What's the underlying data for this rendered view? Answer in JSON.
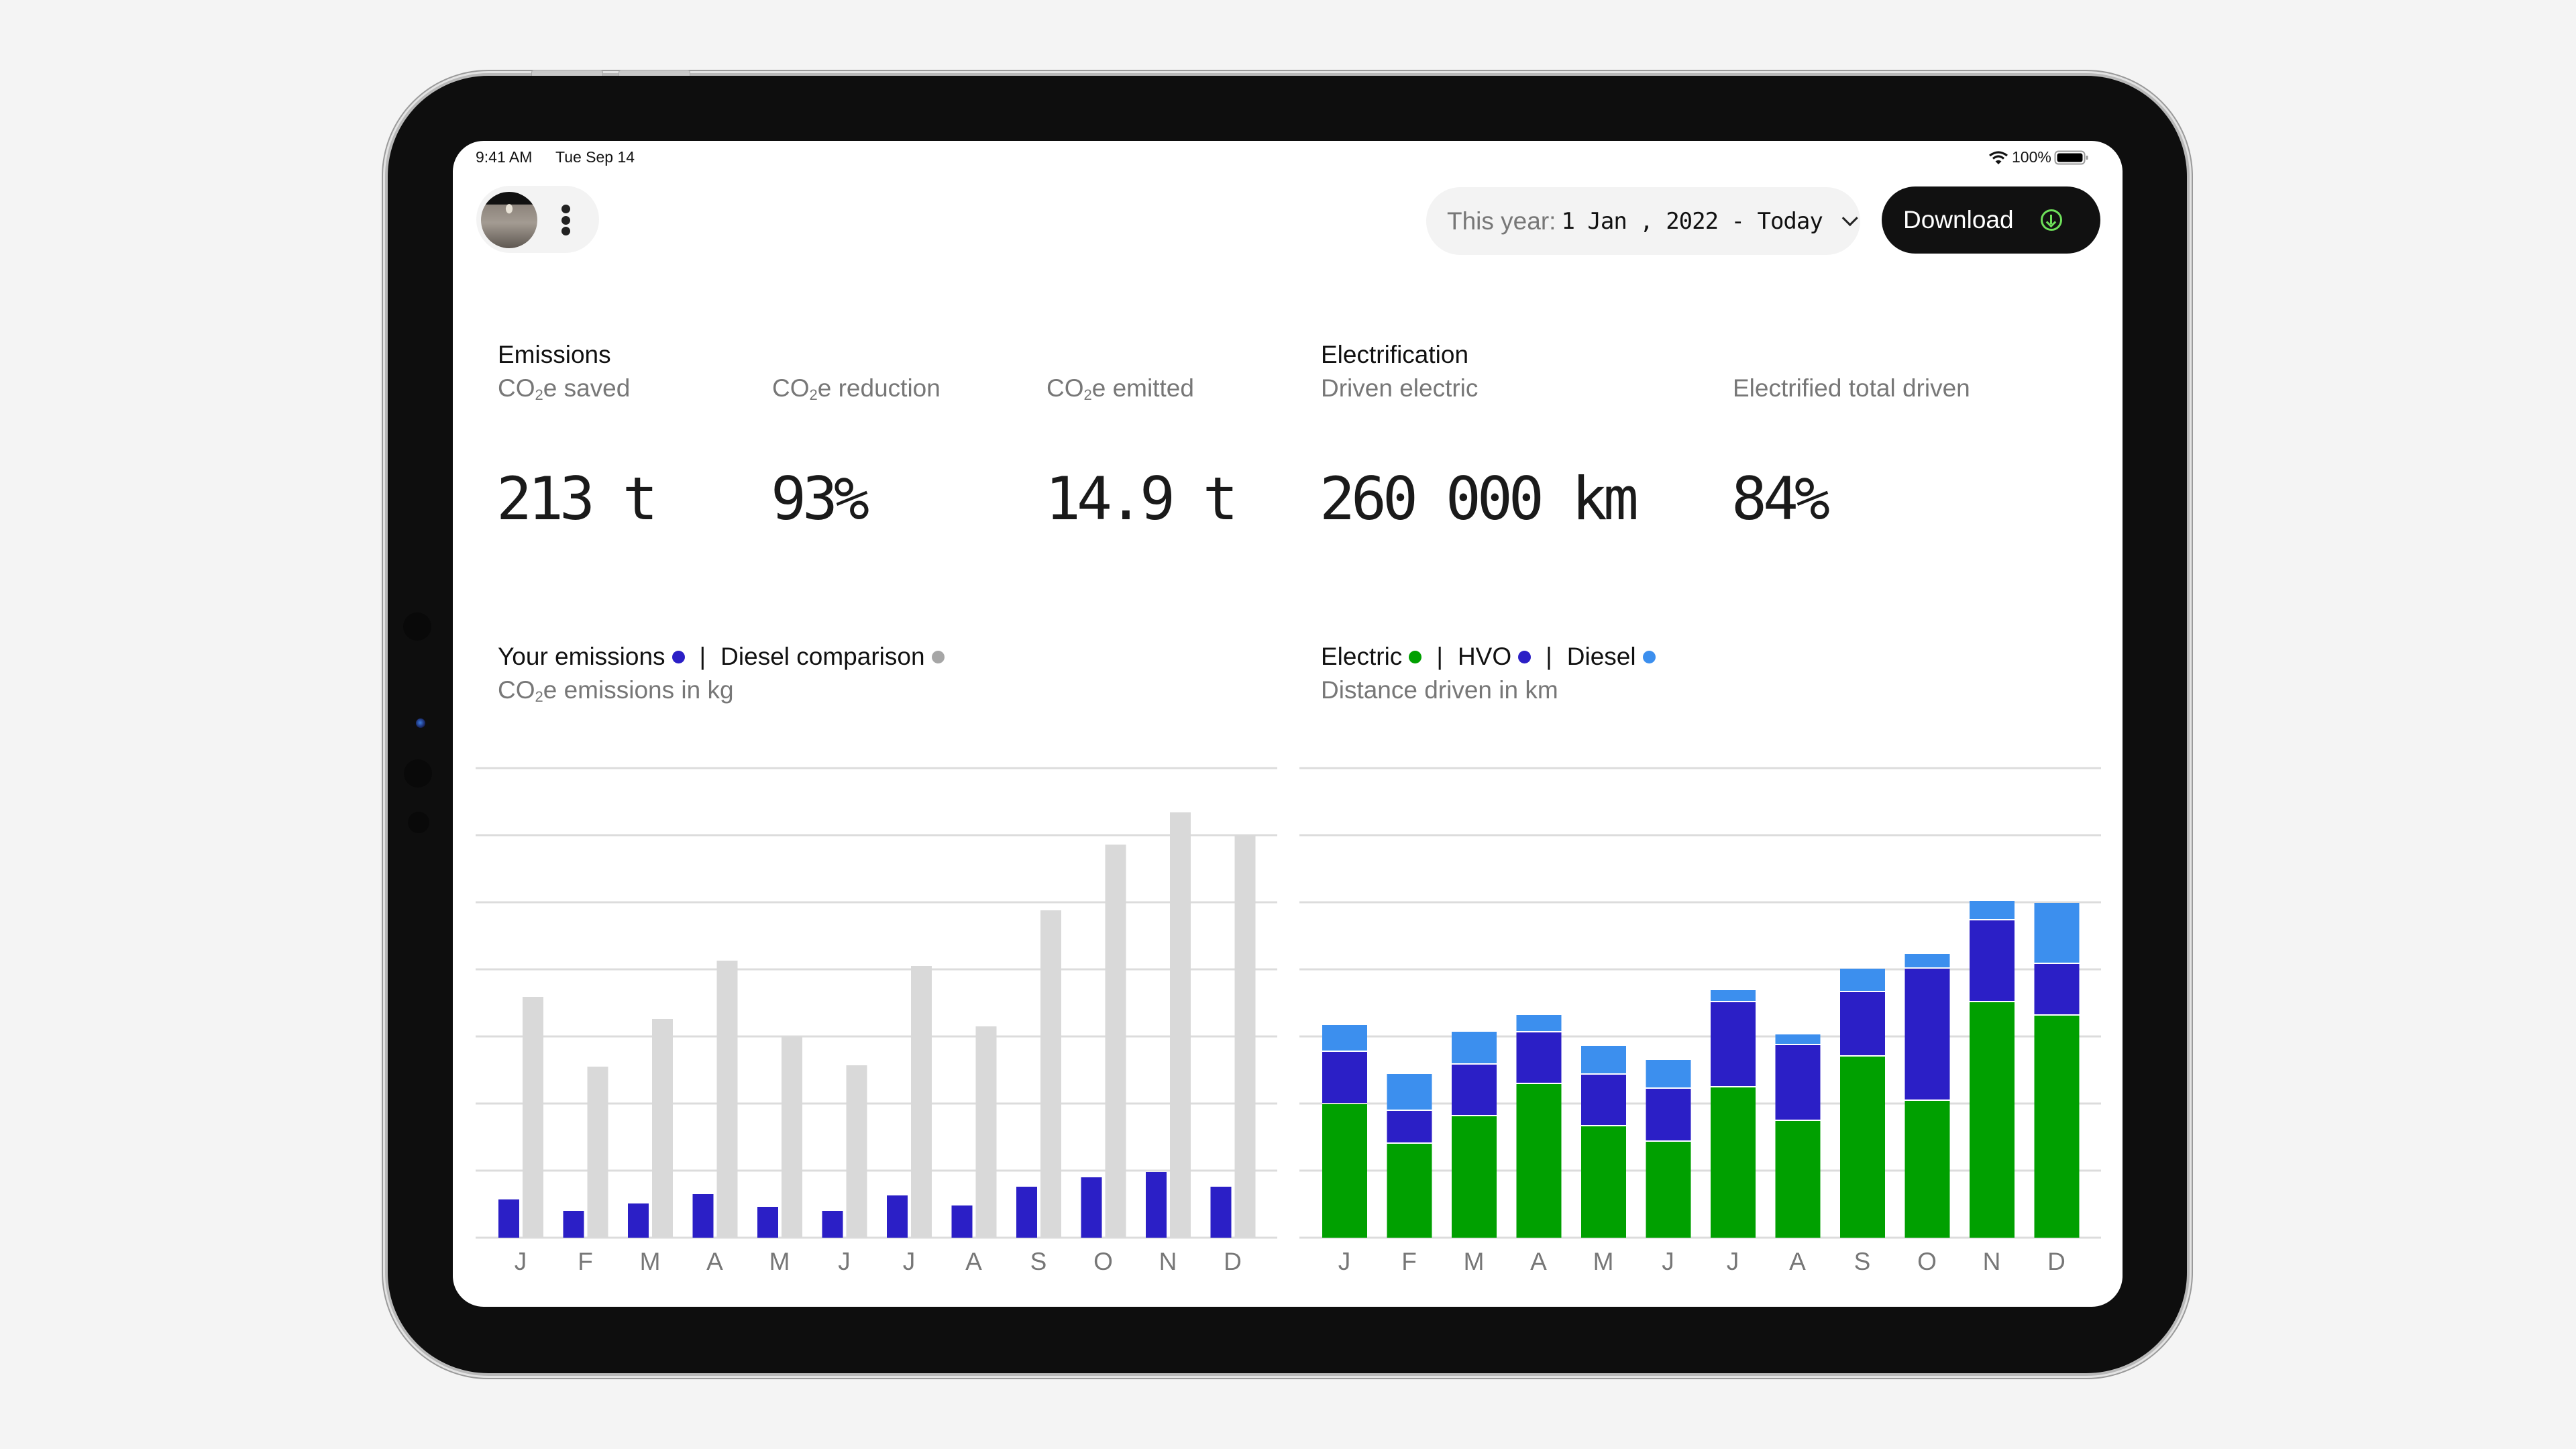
{
  "status_bar": {
    "time": "9:41 AM",
    "date": "Tue Sep 14",
    "battery": "100%",
    "wifi_icon": "wifi-icon",
    "battery_icon": "battery-icon"
  },
  "header": {
    "avatar_icon": "astronaut-avatar",
    "menu_icon": "more-vertical-icon",
    "date_filter": {
      "label": "This year:",
      "value": "1 Jan , 2022 - Today",
      "icon": "chevron-down-icon"
    },
    "download": {
      "label": "Download",
      "icon": "download-circle-icon",
      "icon_color": "#6ee05a"
    }
  },
  "emissions": {
    "title": "Emissions",
    "kpis": [
      {
        "label_pre": "CO",
        "label_sub": "2",
        "label_post": "e saved",
        "value": "213 t"
      },
      {
        "label_pre": "CO",
        "label_sub": "2",
        "label_post": "e reduction",
        "value": "93%"
      },
      {
        "label_pre": "CO",
        "label_sub": "2",
        "label_post": "e emitted",
        "value": "14.9 t"
      }
    ]
  },
  "electrification": {
    "title": "Electrification",
    "kpis": [
      {
        "label": "Driven electric",
        "value": "260 000 km"
      },
      {
        "label": "Electrified total driven",
        "value": "84%"
      }
    ]
  },
  "colors": {
    "your_emissions": "#2b1fc6",
    "diesel_comparison": "#d9d9d9",
    "diesel_comparison_dot": "#a6a6a6",
    "electric": "#00a000",
    "hvo": "#2b1fc6",
    "diesel": "#3c8fee",
    "grid": "#dcdcdc",
    "axis_label": "#777777"
  },
  "chart_data": [
    {
      "type": "bar",
      "title": "Your emissions | Diesel comparison",
      "legend": [
        "Your emissions",
        "Diesel comparison"
      ],
      "subtitle_pre": "CO",
      "subtitle_sub": "2",
      "subtitle_post": "e emissions in kg",
      "ylabel": "CO2e emissions in kg (unlabeled axis; values in gridline units)",
      "xlabel": "",
      "categories": [
        "J",
        "F",
        "M",
        "A",
        "M",
        "J",
        "J",
        "A",
        "S",
        "O",
        "N",
        "D"
      ],
      "series": [
        {
          "name": "Your emissions",
          "values": [
            0.57,
            0.4,
            0.51,
            0.65,
            0.46,
            0.4,
            0.63,
            0.48,
            0.76,
            0.9,
            0.98,
            0.76
          ]
        },
        {
          "name": "Diesel comparison",
          "values": [
            3.59,
            2.55,
            3.26,
            4.13,
            3.0,
            2.57,
            4.05,
            3.15,
            4.88,
            5.86,
            6.34,
            6.0
          ]
        }
      ],
      "ylim": [
        0,
        7
      ],
      "grid": true,
      "grid_lines": 8,
      "legend_placement": "top-left"
    },
    {
      "type": "bar",
      "stacked": true,
      "title": "Electric | HVO | Diesel",
      "legend": [
        "Electric",
        "HVO",
        "Diesel"
      ],
      "subtitle": "Distance driven in km",
      "ylabel": "Distance driven in km (unlabeled axis; values in gridline units)",
      "xlabel": "",
      "categories": [
        "J",
        "F",
        "M",
        "A",
        "M",
        "J",
        "J",
        "A",
        "S",
        "O",
        "N",
        "D"
      ],
      "series": [
        {
          "name": "Electric",
          "values": [
            1.99,
            1.4,
            1.81,
            2.29,
            1.66,
            1.43,
            2.24,
            1.74,
            2.7,
            2.04,
            3.51,
            3.31
          ]
        },
        {
          "name": "HVO",
          "values": [
            0.78,
            0.49,
            0.77,
            0.77,
            0.77,
            0.79,
            1.27,
            1.13,
            0.96,
            1.97,
            1.22,
            0.77
          ]
        },
        {
          "name": "Diesel",
          "values": [
            0.4,
            0.55,
            0.49,
            0.26,
            0.43,
            0.43,
            0.18,
            0.16,
            0.35,
            0.22,
            0.29,
            0.91
          ]
        }
      ],
      "ylim": [
        0,
        7
      ],
      "grid": true,
      "grid_lines": 8,
      "legend_placement": "top-left"
    }
  ]
}
